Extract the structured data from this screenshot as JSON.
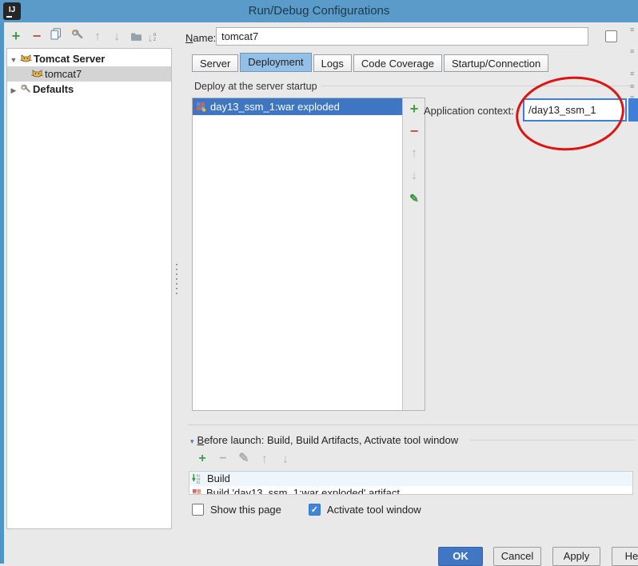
{
  "window": {
    "title": "Run/Debug Configurations"
  },
  "name_row": {
    "label_accel": "N",
    "label_rest": "ame:",
    "value": "tomcat7",
    "share_checkbox_checked": false
  },
  "tree": {
    "items": [
      {
        "label": "Tomcat Server",
        "expanded": true
      },
      {
        "label": "tomcat7",
        "selected": true
      },
      {
        "label": "Defaults",
        "expanded": false
      }
    ]
  },
  "tabs": {
    "active": "Deployment",
    "items": [
      {
        "label": "Server"
      },
      {
        "label": "Deployment"
      },
      {
        "label": "Logs"
      },
      {
        "label": "Code Coverage"
      },
      {
        "label": "Startup/Connection"
      }
    ]
  },
  "deployment": {
    "group_label": "Deploy at the server startup",
    "artifacts": [
      {
        "label": "day13_ssm_1:war exploded",
        "selected": true
      }
    ],
    "application_context": {
      "label": "Application context:",
      "value": "/day13_ssm_1"
    }
  },
  "before_launch": {
    "header_accel": "B",
    "header_rest": "efore launch: Build, Build Artifacts, Activate tool window",
    "tasks": [
      {
        "label": "Build"
      },
      {
        "label": "Build 'day13_ssm_1:war exploded' artifact",
        "clipped": true
      }
    ]
  },
  "footer": {
    "show_this_page": {
      "label": "Show this page",
      "checked": false
    },
    "activate_tool_window": {
      "label": "Activate tool window",
      "checked": true
    },
    "buttons": {
      "ok": "OK",
      "cancel": "Cancel",
      "apply": "Apply",
      "help": "Help"
    }
  },
  "icons": {
    "add": "+",
    "remove": "−",
    "move_up": "↑",
    "move_down": "↓",
    "edit": "✎",
    "check": "✓",
    "expanded": "▼",
    "collapsed": "▶",
    "section": "▾",
    "logo_text": "IJ",
    "fragment": "≡"
  },
  "colors": {
    "titlebar": "#5b9bc9",
    "selection_blue": "#3e76c3",
    "tab_active": "#93c0e6",
    "ok_button": "#4076c4",
    "annotation_red": "#dd1410",
    "checkbox_checked": "#4285d8"
  }
}
